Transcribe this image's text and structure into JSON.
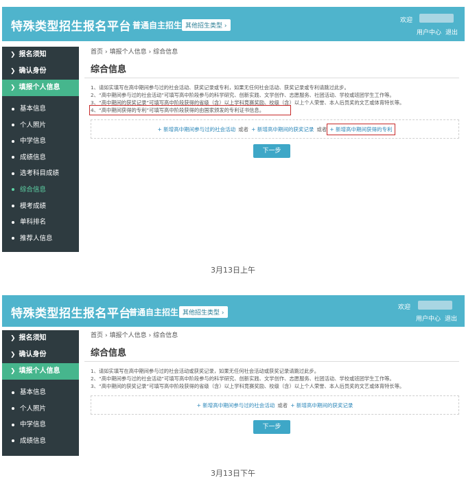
{
  "platform_title": "特殊类型招生报名平台",
  "program": "普通自主招生",
  "other_types_button": "其他招生类型",
  "welcome": "欢迎",
  "user_center": "用户中心",
  "logout": "退出",
  "breadcrumb": [
    "首页",
    "填报个人信息",
    "综合信息"
  ],
  "page_title": "综合信息",
  "next_button": "下一步",
  "or_text": "或者",
  "add_activity": "+ 新增高中期间参与过的社会活动",
  "add_award": "+ 新增高中期间的获奖记录",
  "add_patent": "+ 新增高中期间获得的专利",
  "icons": {
    "chevron": "chevron-right-icon",
    "bullet": "dot-icon"
  },
  "colors": {
    "header": "#4fb4cc",
    "sidebar": "#2e3b40",
    "active_nav": "#46b68d",
    "active_sub": "#5fd6a7",
    "highlight": "#c62828"
  },
  "morning": {
    "caption": "3月13日上午",
    "nav": [
      {
        "label": "报名须知",
        "active": false
      },
      {
        "label": "确认身份",
        "active": false
      },
      {
        "label": "填报个人信息",
        "active": true
      }
    ],
    "sub_items": [
      {
        "label": "基本信息",
        "active": false
      },
      {
        "label": "个人照片",
        "active": false
      },
      {
        "label": "中学信息",
        "active": false
      },
      {
        "label": "成绩信息",
        "active": false
      },
      {
        "label": "选考科目成绩",
        "active": false
      },
      {
        "label": "综合信息",
        "active": true
      },
      {
        "label": "模考成绩",
        "active": false
      },
      {
        "label": "单科排名",
        "active": false
      },
      {
        "label": "推荐人信息",
        "active": false
      }
    ],
    "notes": [
      "1、请如实填写在高中期间参与过的社会活动、获奖记录或专利，如果无任何社会活动、获奖记录或专利请跳过此步。",
      "2、“高中期间参与过的社会活动”可填写高中阶段参与的科学研究、创新实践、文学创作、志愿服务、社团活动、学校或班团学生工作等。",
      "3、“高中期间的获奖记录”可填写高中阶段获得的省级（含）以上学科竞赛奖励、校级（含）以上个人荣誉、本人后员奖的文艺或体育特长等。",
      "4、“高中期间获得的专利”可填写高中阶段获得的由国家颁发的专利证书信息。"
    ]
  },
  "afternoon": {
    "caption": "3月13日下午",
    "nav": [
      {
        "label": "报名须知",
        "active": false
      },
      {
        "label": "确认身份",
        "active": false
      },
      {
        "label": "填报个人信息",
        "active": true
      }
    ],
    "sub_items": [
      {
        "label": "基本信息",
        "active": false
      },
      {
        "label": "个人照片",
        "active": false
      },
      {
        "label": "中学信息",
        "active": false
      },
      {
        "label": "成绩信息",
        "active": false
      }
    ],
    "notes": [
      "1、请如实填写在高中期间参与过的社会活动或获奖记录，如果无任何社会活动或获奖记录请跳过此步。",
      "2、“高中期间参与过的社会活动”可填写高中阶段参与的科学研究、创新实践、文学创作、志愿服务、社团活动、学校或班团学生工作等。",
      "3、“高中期间的获奖记录”可填写高中阶段获得的省级（含）以上学科竞赛奖励、校级（含）以上个人荣誉、本人后员奖的文艺或体育特长等。"
    ]
  }
}
